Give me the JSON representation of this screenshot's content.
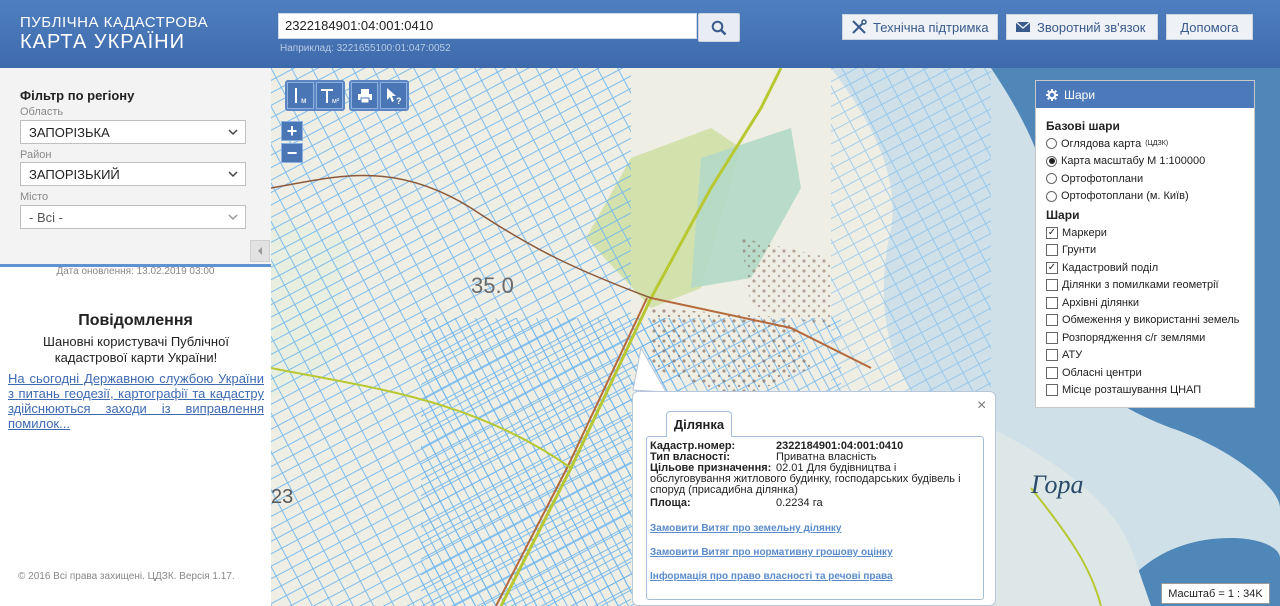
{
  "header": {
    "logo_line1": "ПУБЛІЧНА КАДАСТРОВА",
    "logo_line2": "КАРТА УКРАЇНИ",
    "search_value": "2322184901:04:001:0410",
    "search_hint": "Наприклад: 3221655100:01:047:0052",
    "support_label": "Технічна підтримка",
    "feedback_label": "Зворотний зв'язок",
    "help_label": "Допомога"
  },
  "filter": {
    "title": "Фільтр по регіону",
    "oblast_label": "Область",
    "oblast_value": "ЗАПОРІЗЬКА",
    "rayon_label": "Район",
    "rayon_value": "ЗАПОРІЗЬКИЙ",
    "city_label": "Місто",
    "city_value": "- Всі -"
  },
  "update_date": "Дата оновлення: 13.02.2019 03:00",
  "notice": {
    "title": "Повідомлення",
    "text": "Шановні користувачі Публічної кадастрової карти України!",
    "link": "На сьогодні Державною службою України з питань геодезії, картографії та кадастру здійснюються заходи із виправлення помилок..."
  },
  "footer": "© 2016 Всі права захищені. ЦДЗК. Версія 1.17.",
  "tools": {
    "ruler_sub": "м",
    "area_sub": "м²",
    "print_icon": "printer-icon",
    "info_icon": "pointer-question-icon"
  },
  "zoom": {
    "in": "+",
    "out": "−"
  },
  "layers": {
    "title": "Шари",
    "base_title": "Базові шари",
    "base": [
      {
        "label": "Оглядова карта",
        "sup": "(ЦДЗК)",
        "selected": false
      },
      {
        "label": "Карта масштабу М 1:100000",
        "sup": "",
        "selected": true
      },
      {
        "label": "Ортофотоплани",
        "sup": "",
        "selected": false
      },
      {
        "label": "Ортофотоплани (м. Київ)",
        "sup": "",
        "selected": false
      }
    ],
    "overlay_title": "Шари",
    "overlays": [
      {
        "label": "Маркери",
        "checked": true
      },
      {
        "label": "Грунти",
        "checked": false
      },
      {
        "label": "Кадастровий поділ",
        "checked": true
      },
      {
        "label": "Ділянки з помилками геометрії",
        "checked": false
      },
      {
        "label": "Архівні ділянки",
        "checked": false
      },
      {
        "label": "Обмеження у використанні земель",
        "checked": false
      },
      {
        "label": "Розпорядження с/г землями",
        "checked": false
      },
      {
        "label": "АТУ",
        "checked": false
      },
      {
        "label": "Обласні центри",
        "checked": false
      },
      {
        "label": "Місце розташування ЦНАП",
        "checked": false
      }
    ]
  },
  "popup": {
    "tab": "Ділянка",
    "close": "×",
    "rows": [
      {
        "k": "Кадастр.номер:",
        "v": "2322184901:04:001:0410"
      },
      {
        "k": "Тип власності:",
        "v": "Приватна власність"
      },
      {
        "k": "Цільове призначення:",
        "v": "02.01 Для будівництва і"
      },
      {
        "k": "",
        "v": "обслуговування житлового будинку, господарських будівель і"
      },
      {
        "k": "",
        "v": "споруд (присадибна ділянка)"
      },
      {
        "k": "Площа:",
        "v": "0.2234 га"
      }
    ],
    "links": [
      "Замовити Витяг про земельну ділянку",
      "Замовити Витяг про нормативну грошову оцінку",
      "Інформація про право власності та речові права"
    ]
  },
  "map_labels": {
    "l1": "35.0",
    "l2": "Гора",
    "l3": "23"
  },
  "scale": "Масштаб = 1 : 34K",
  "colors": {
    "header": "#4f7fc0",
    "accent": "#4c79b9",
    "parcel": "#6ab4f0",
    "road": "#b8c832"
  }
}
